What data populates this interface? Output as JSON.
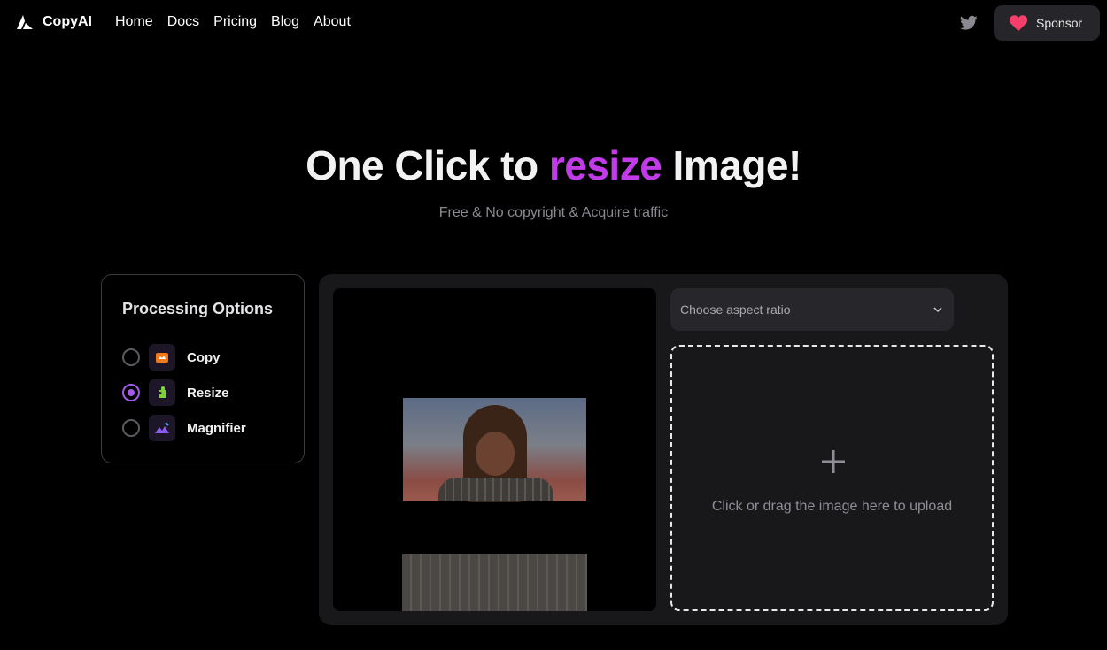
{
  "nav": {
    "brand": "CopyAI",
    "links": [
      "Home",
      "Docs",
      "Pricing",
      "Blog",
      "About"
    ],
    "sponsor_label": "Sponsor"
  },
  "hero": {
    "title_before": "One Click to ",
    "title_accent": "resize",
    "title_after": " Image!",
    "subtitle": "Free & No copyright & Acquire traffic"
  },
  "options": {
    "title": "Processing Options",
    "items": [
      {
        "label": "Copy",
        "icon": "copy-icon",
        "checked": false
      },
      {
        "label": "Resize",
        "icon": "puzzle-icon",
        "checked": true
      },
      {
        "label": "Magnifier",
        "icon": "mountain-image-icon",
        "checked": false
      }
    ]
  },
  "workspace": {
    "aspect_select_placeholder": "Choose aspect ratio",
    "dropzone_text": "Click or drag the image here to upload"
  },
  "colors": {
    "accent": "#c23be8",
    "radio_checked": "#a35ce8",
    "sponsor_heart": "#f43f6b"
  }
}
